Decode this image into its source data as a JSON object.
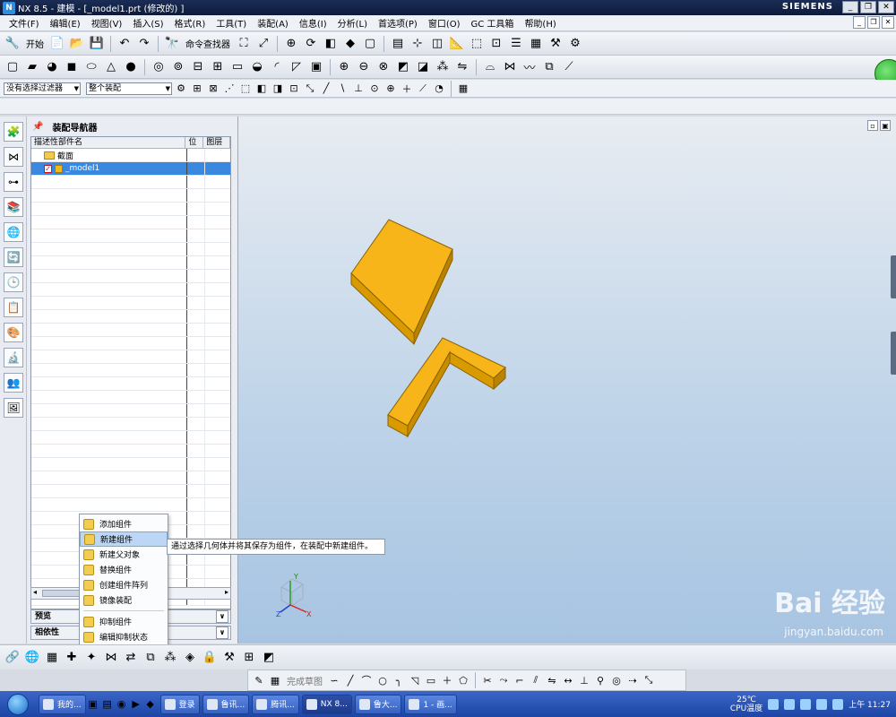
{
  "window": {
    "title": "NX 8.5 - 建模 - [_model1.prt  (修改的) ]",
    "brand": "SIEMENS",
    "controls": [
      "_",
      "❐",
      "✕"
    ]
  },
  "menubar": {
    "items": [
      "文件(F)",
      "编辑(E)",
      "视图(V)",
      "插入(S)",
      "格式(R)",
      "工具(T)",
      "装配(A)",
      "信息(I)",
      "分析(L)",
      "首选项(P)",
      "窗口(O)",
      "GC 工具箱",
      "帮助(H)"
    ]
  },
  "toolbar": {
    "start_label": "开始",
    "command_finder": "命令查找器",
    "filter_value": "没有选择过滤器",
    "scope_value": "整个装配"
  },
  "navigator": {
    "title": "装配导航器",
    "columns": [
      "描述性部件名",
      "位",
      "图层"
    ],
    "rows": [
      {
        "name": "截面",
        "kind": "folder"
      },
      {
        "name": "_model1",
        "kind": "part",
        "checked": true
      }
    ],
    "sections": [
      "预览",
      "相依性"
    ]
  },
  "context_menu": {
    "items": [
      "添加组件",
      "新建组件",
      "新建父对象",
      "替换组件",
      "创建组件阵列",
      "镜像装配",
      "抑制组件",
      "编辑抑制状态"
    ],
    "highlighted_index": 1
  },
  "tooltip": {
    "text": "通过选择几何体并将其保存为组件，在装配中新建组件。"
  },
  "sketch": {
    "finish_label": "完成草图"
  },
  "axes": {
    "x": "X",
    "y": "Y",
    "z": "Z"
  },
  "watermark": {
    "main": "Bai 经验",
    "sub": "jingyan.baidu.com"
  },
  "taskbar": {
    "tasks": [
      "我的...",
      "登录",
      "鲁讯...",
      "腾讯...",
      "NX 8...",
      "鲁大...",
      "1 - 画..."
    ],
    "active_index": 4,
    "temp": "25℃",
    "temp_label": "CPU温度",
    "clock": "上午 11:27"
  },
  "colors": {
    "part_fill": "#f7b519",
    "part_side": "#d99a00",
    "selection": "#3b88e0",
    "viewport_top": "#e8ecf2",
    "viewport_bottom": "#a7c4e2"
  }
}
